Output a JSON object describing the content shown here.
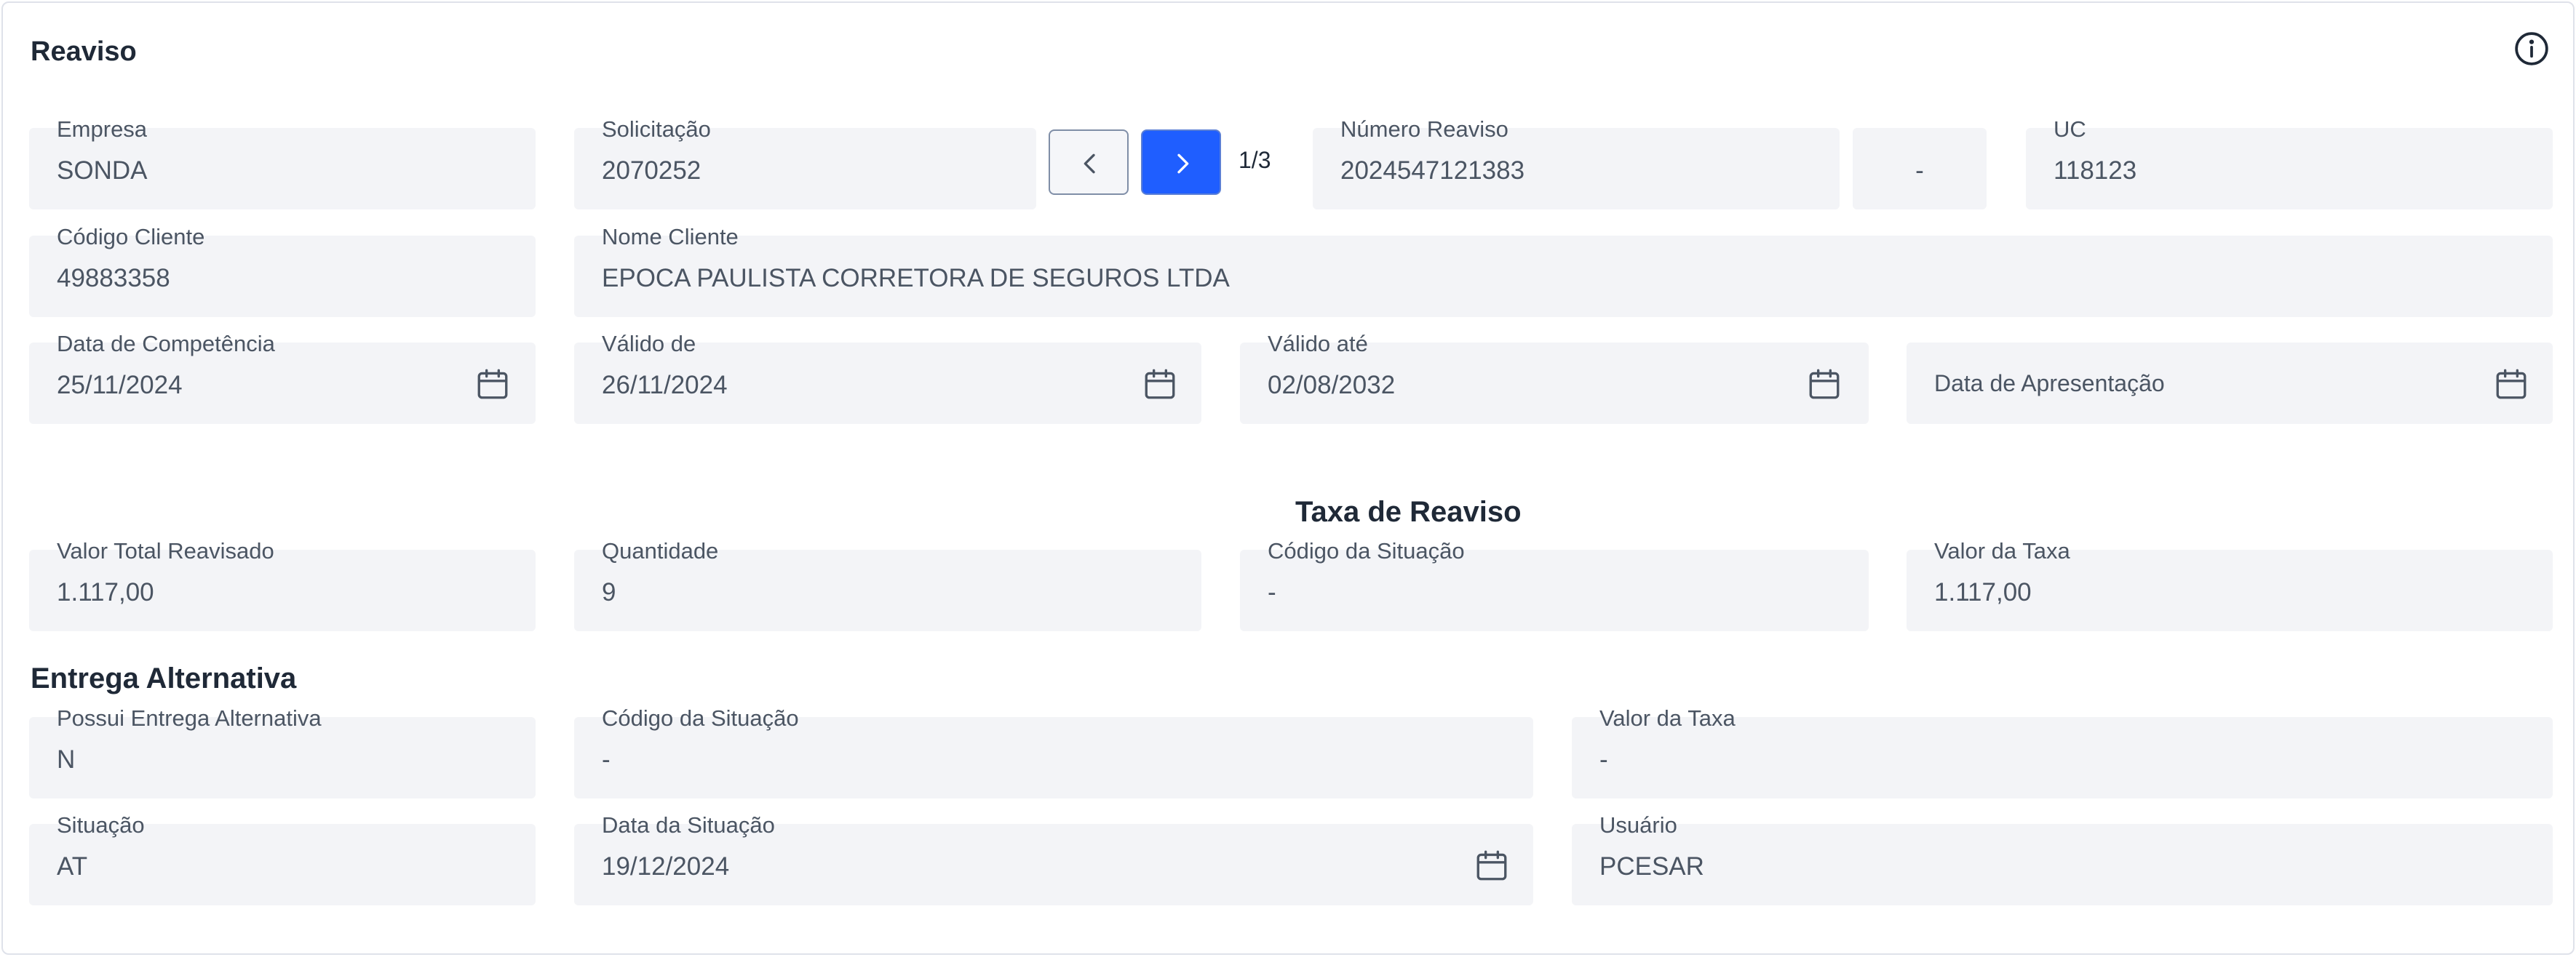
{
  "panel": {
    "title": "Reaviso",
    "info_icon": "info-circle-icon"
  },
  "empresa": {
    "label": "Empresa",
    "value": "SONDA"
  },
  "solicitacao": {
    "label": "Solicitação",
    "value": "2070252"
  },
  "pagination": {
    "current": "1/3",
    "prev_icon": "chevron-left-icon",
    "next_icon": "chevron-right-icon"
  },
  "numero_reaviso": {
    "label": "Número Reaviso",
    "value": "2024547121383",
    "suffix": "-"
  },
  "uc": {
    "label": "UC",
    "value": "118123"
  },
  "codigo_cliente": {
    "label": "Código Cliente",
    "value": "49883358"
  },
  "nome_cliente": {
    "label": "Nome Cliente",
    "value": "EPOCA PAULISTA CORRETORA DE SEGUROS LTDA"
  },
  "data_competencia": {
    "label": "Data de Competência",
    "value": "25/11/2024"
  },
  "valido_de": {
    "label": "Válido de",
    "value": "26/11/2024"
  },
  "valido_ate": {
    "label": "Válido até",
    "value": "02/08/2032"
  },
  "data_apresentacao": {
    "placeholder": "Data de Apresentação"
  },
  "taxa_reaviso": {
    "title": "Taxa de Reaviso",
    "valor_total": {
      "label": "Valor Total Reavisado",
      "value": "1.117,00"
    },
    "quantidade": {
      "label": "Quantidade",
      "value": "9"
    },
    "codigo_situacao": {
      "label": "Código da Situação",
      "value": "-"
    },
    "valor_taxa": {
      "label": "Valor da Taxa",
      "value": "1.117,00"
    }
  },
  "entrega_alternativa": {
    "title": "Entrega Alternativa",
    "possui": {
      "label": "Possui Entrega Alternativa",
      "value": "N"
    },
    "codigo_situacao": {
      "label": "Código da Situação",
      "value": "-"
    },
    "valor_taxa": {
      "label": "Valor da Taxa",
      "value": "-"
    },
    "situacao": {
      "label": "Situação",
      "value": "AT"
    },
    "data_situacao": {
      "label": "Data da Situação",
      "value": "19/12/2024"
    },
    "usuario": {
      "label": "Usuário",
      "value": "PCESAR"
    }
  },
  "colors": {
    "accent": "#1f5eff",
    "field_bg": "#f3f4f7",
    "text": "#1f2937",
    "muted": "#4b5563"
  }
}
